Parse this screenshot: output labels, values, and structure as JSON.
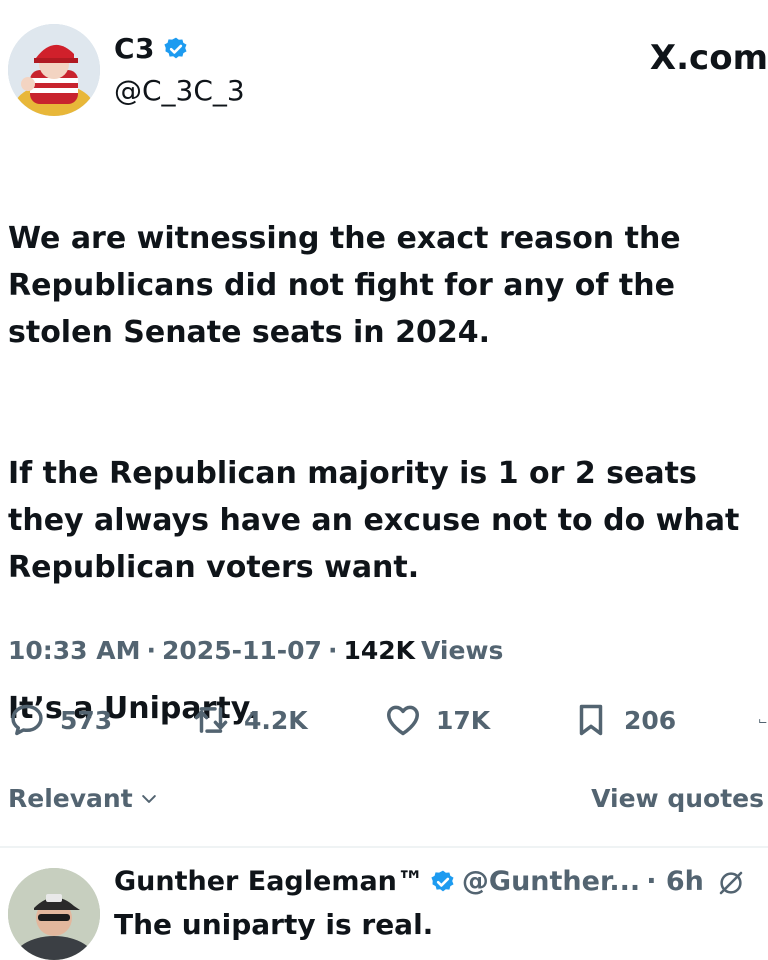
{
  "post": {
    "author_name": "C3",
    "author_handle": "@C_3C_3",
    "site": "X.com",
    "paragraphs": [
      "We are witnessing the exact reason the Republicans did not fight for any of the stolen Senate seats in 2024.",
      "If the Republican majority is 1 or 2 seats they always have an excuse not to do what Republican voters want.",
      "It’s a Uniparty."
    ],
    "time": "10:33 AM",
    "date": "2025-11-07",
    "views_count": "142K",
    "views_label": "Views",
    "separator": "·"
  },
  "actions": {
    "replies": "573",
    "reposts": "4.2K",
    "likes": "17K",
    "bookmarks": "206"
  },
  "sort": {
    "selected": "Relevant",
    "view_quotes": "View quotes"
  },
  "reply": {
    "name": "Gunther Eagleman™",
    "handle": "@Gunther...",
    "age": "· 6h",
    "text": "The uniparty is real."
  },
  "colors": {
    "text": "#0f1419",
    "secondary": "#536471",
    "verified_blue": "#1d9bf0"
  }
}
